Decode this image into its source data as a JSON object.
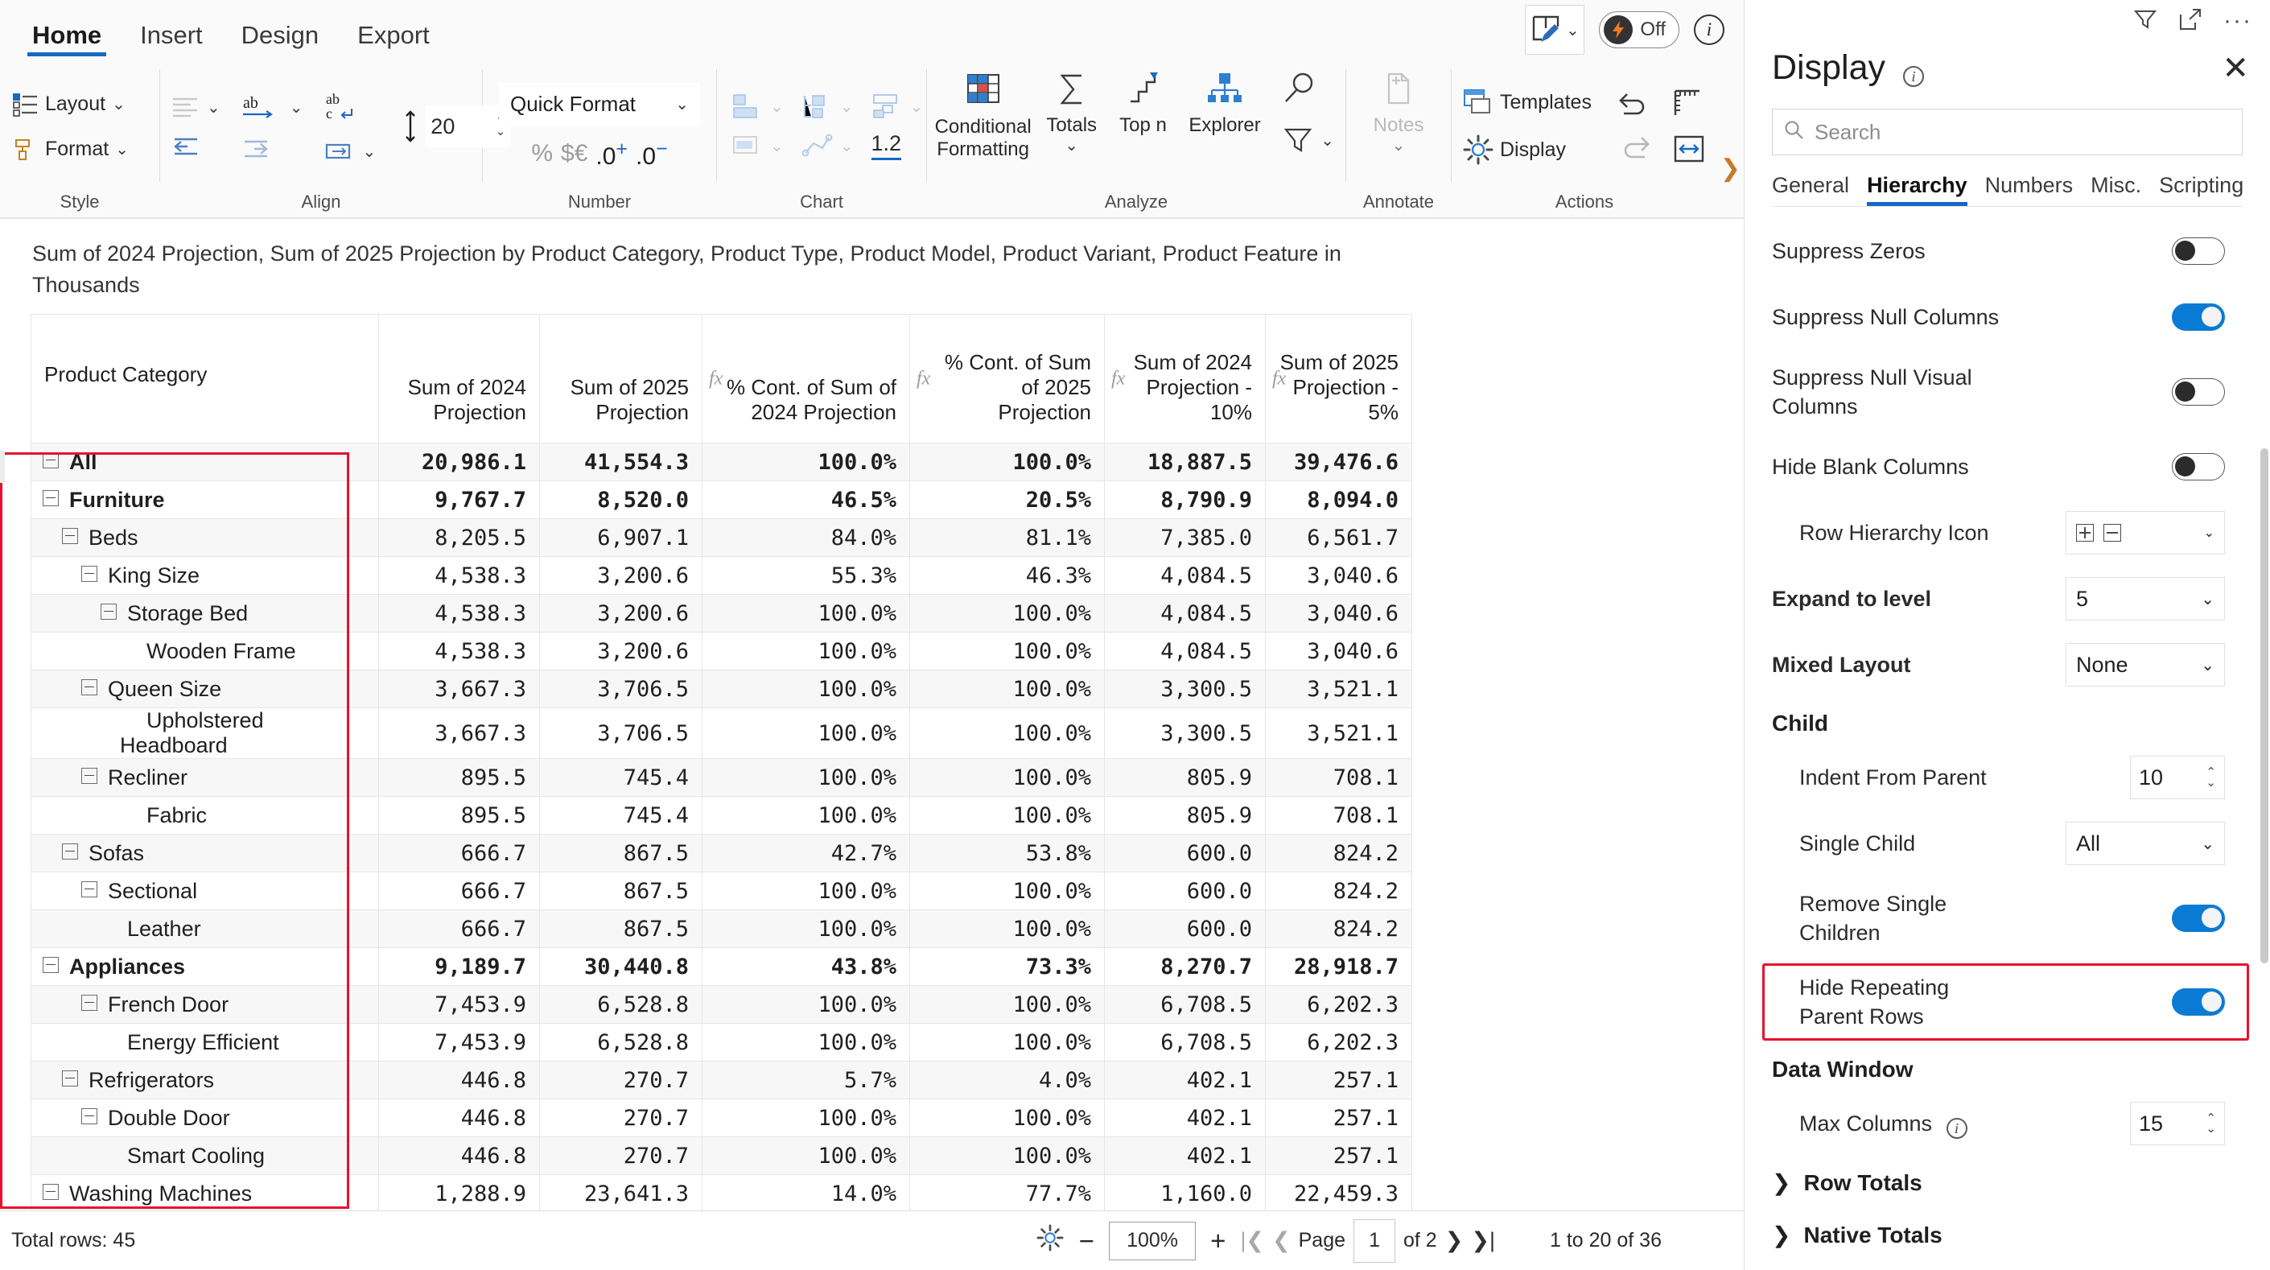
{
  "ribbon": {
    "tabs": [
      {
        "label": "Home",
        "active": true
      },
      {
        "label": "Insert",
        "active": false
      },
      {
        "label": "Design",
        "active": false
      },
      {
        "label": "Export",
        "active": false
      }
    ],
    "pen_button": "edit-mode",
    "power_toggle_label": "Off",
    "groups": {
      "style": {
        "title": "Style",
        "layout_label": "Layout",
        "format_label": "Format"
      },
      "align": {
        "title": "Align",
        "line_height_value": "20"
      },
      "number": {
        "title": "Number",
        "quick_format_label": "Quick Format",
        "percent": "%",
        "currency": "$€",
        "inc_dec": ".0",
        "dec_dec": ".0"
      },
      "chart": {
        "title": "Chart",
        "number_fmt": "1.2"
      },
      "analyze": {
        "title": "Analyze",
        "conditional_formatting_label": "Conditional Formatting",
        "totals_label": "Totals",
        "topn_label": "Top n",
        "explorer_label": "Explorer"
      },
      "annotate": {
        "title": "Annotate",
        "notes_label": "Notes"
      },
      "actions": {
        "title": "Actions",
        "templates_label": "Templates",
        "display_label": "Display"
      }
    }
  },
  "report": {
    "caption": "Sum of 2024 Projection, Sum of 2025 Projection by Product Category, Product Type, Product Model, Product Variant, Product Feature in Thousands"
  },
  "table": {
    "columns": [
      {
        "label": "Product Category",
        "fx": false,
        "type": "row"
      },
      {
        "label": "Sum of 2024 Projection",
        "fx": false,
        "type": "num"
      },
      {
        "label": "Sum of 2025 Projection",
        "fx": false,
        "type": "num"
      },
      {
        "label": "% Cont. of Sum of 2024 Projection",
        "fx": true,
        "type": "num"
      },
      {
        "label": "% Cont. of Sum of 2025 Projection",
        "fx": true,
        "type": "num"
      },
      {
        "label": "Sum of 2024 Projection - 10%",
        "fx": true,
        "type": "num"
      },
      {
        "label": "Sum of 2025 Projection - 5%",
        "fx": true,
        "type": "num"
      }
    ],
    "rows": [
      {
        "label": "All",
        "level": 0,
        "expandable": true,
        "bold": true,
        "alt": true,
        "values": [
          "20,986.1",
          "41,554.3",
          "100.0%",
          "100.0%",
          "18,887.5",
          "39,476.6"
        ]
      },
      {
        "label": "Furniture",
        "level": 0,
        "expandable": true,
        "bold": true,
        "alt": false,
        "values": [
          "9,767.7",
          "8,520.0",
          "46.5%",
          "20.5%",
          "8,790.9",
          "8,094.0"
        ]
      },
      {
        "label": "Beds",
        "level": 1,
        "expandable": true,
        "bold": false,
        "alt": true,
        "values": [
          "8,205.5",
          "6,907.1",
          "84.0%",
          "81.1%",
          "7,385.0",
          "6,561.7"
        ]
      },
      {
        "label": "King Size",
        "level": 2,
        "expandable": true,
        "bold": false,
        "alt": false,
        "values": [
          "4,538.3",
          "3,200.6",
          "55.3%",
          "46.3%",
          "4,084.5",
          "3,040.6"
        ]
      },
      {
        "label": "Storage Bed",
        "level": 3,
        "expandable": true,
        "bold": false,
        "alt": true,
        "values": [
          "4,538.3",
          "3,200.6",
          "100.0%",
          "100.0%",
          "4,084.5",
          "3,040.6"
        ]
      },
      {
        "label": "Wooden Frame",
        "level": 4,
        "expandable": false,
        "bold": false,
        "alt": false,
        "values": [
          "4,538.3",
          "3,200.6",
          "100.0%",
          "100.0%",
          "4,084.5",
          "3,040.6"
        ]
      },
      {
        "label": "Queen Size",
        "level": 2,
        "expandable": true,
        "bold": false,
        "alt": true,
        "values": [
          "3,667.3",
          "3,706.5",
          "100.0%",
          "100.0%",
          "3,300.5",
          "3,521.1"
        ]
      },
      {
        "label": "Upholstered Headboard",
        "level": 4,
        "expandable": false,
        "bold": false,
        "alt": false,
        "values": [
          "3,667.3",
          "3,706.5",
          "100.0%",
          "100.0%",
          "3,300.5",
          "3,521.1"
        ]
      },
      {
        "label": "Recliner",
        "level": 2,
        "expandable": true,
        "bold": false,
        "alt": true,
        "values": [
          "895.5",
          "745.4",
          "100.0%",
          "100.0%",
          "805.9",
          "708.1"
        ]
      },
      {
        "label": "Fabric",
        "level": 4,
        "expandable": false,
        "bold": false,
        "alt": false,
        "values": [
          "895.5",
          "745.4",
          "100.0%",
          "100.0%",
          "805.9",
          "708.1"
        ]
      },
      {
        "label": "Sofas",
        "level": 1,
        "expandable": true,
        "bold": false,
        "alt": true,
        "values": [
          "666.7",
          "867.5",
          "42.7%",
          "53.8%",
          "600.0",
          "824.2"
        ]
      },
      {
        "label": "Sectional",
        "level": 2,
        "expandable": true,
        "bold": false,
        "alt": false,
        "values": [
          "666.7",
          "867.5",
          "100.0%",
          "100.0%",
          "600.0",
          "824.2"
        ]
      },
      {
        "label": "Leather",
        "level": 3,
        "expandable": false,
        "bold": false,
        "alt": true,
        "values": [
          "666.7",
          "867.5",
          "100.0%",
          "100.0%",
          "600.0",
          "824.2"
        ]
      },
      {
        "label": "Appliances",
        "level": 0,
        "expandable": true,
        "bold": true,
        "alt": false,
        "values": [
          "9,189.7",
          "30,440.8",
          "43.8%",
          "73.3%",
          "8,270.7",
          "28,918.7"
        ]
      },
      {
        "label": "French Door",
        "level": 2,
        "expandable": true,
        "bold": false,
        "alt": true,
        "values": [
          "7,453.9",
          "6,528.8",
          "100.0%",
          "100.0%",
          "6,708.5",
          "6,202.3"
        ]
      },
      {
        "label": "Energy Efficient",
        "level": 3,
        "expandable": false,
        "bold": false,
        "alt": false,
        "values": [
          "7,453.9",
          "6,528.8",
          "100.0%",
          "100.0%",
          "6,708.5",
          "6,202.3"
        ]
      },
      {
        "label": "Refrigerators",
        "level": 1,
        "expandable": true,
        "bold": false,
        "alt": true,
        "values": [
          "446.8",
          "270.7",
          "5.7%",
          "4.0%",
          "402.1",
          "257.1"
        ]
      },
      {
        "label": "Double Door",
        "level": 2,
        "expandable": true,
        "bold": false,
        "alt": false,
        "values": [
          "446.8",
          "270.7",
          "100.0%",
          "100.0%",
          "402.1",
          "257.1"
        ]
      },
      {
        "label": "Smart Cooling",
        "level": 3,
        "expandable": false,
        "bold": false,
        "alt": true,
        "values": [
          "446.8",
          "270.7",
          "100.0%",
          "100.0%",
          "402.1",
          "257.1"
        ]
      },
      {
        "label": "Washing Machines",
        "level": 0,
        "expandable": true,
        "bold": false,
        "alt": false,
        "values": [
          "1,288.9",
          "23,641.3",
          "14.0%",
          "77.7%",
          "1,160.0",
          "22,459.3"
        ]
      }
    ]
  },
  "status": {
    "total_rows": "Total rows: 45",
    "zoom": "100%",
    "minus": "−",
    "plus": "+",
    "page_word": "Page",
    "page_value": "1",
    "page_of": "of 2",
    "range": "1 to 20 of 36"
  },
  "panel": {
    "title": "Display",
    "close": "✕",
    "search_placeholder": "Search",
    "tabs": [
      {
        "label": "General",
        "active": false
      },
      {
        "label": "Hierarchy",
        "active": true
      },
      {
        "label": "Numbers",
        "active": false
      },
      {
        "label": "Misc.",
        "active": false
      },
      {
        "label": "Scripting",
        "active": false
      }
    ],
    "settings": [
      {
        "label": "Suppress Zeros",
        "type": "toggle",
        "value": "off",
        "indent": false
      },
      {
        "label": "Suppress Null Columns",
        "type": "toggle",
        "value": "on",
        "indent": false
      },
      {
        "label": "Suppress Null Visual Columns",
        "type": "toggle",
        "value": "off",
        "indent": false
      },
      {
        "label": "Hide Blank Columns",
        "type": "toggle",
        "value": "off",
        "indent": false
      },
      {
        "label": "Row Hierarchy Icon",
        "type": "icon-select",
        "value": "plus-minus",
        "indent": true
      },
      {
        "label": "Expand to level",
        "type": "select",
        "value": "5",
        "indent": false,
        "bold": true
      },
      {
        "label": "Mixed Layout",
        "type": "select",
        "value": "None",
        "indent": false,
        "bold": true
      }
    ],
    "child_section": {
      "title": "Child",
      "items": [
        {
          "label": "Indent From Parent",
          "type": "stepper",
          "value": "10"
        },
        {
          "label": "Single Child",
          "type": "select",
          "value": "All"
        },
        {
          "label": "Remove Single Children",
          "type": "toggle",
          "value": "on"
        },
        {
          "label": "Hide Repeating Parent Rows",
          "type": "toggle",
          "value": "on",
          "highlighted": true
        }
      ]
    },
    "data_window_section": {
      "title": "Data Window",
      "items": [
        {
          "label": "Max Columns",
          "type": "stepper",
          "value": "15",
          "info": true
        }
      ]
    },
    "collapsed_sections": [
      {
        "label": "Row Totals"
      },
      {
        "label": "Native Totals"
      }
    ]
  }
}
